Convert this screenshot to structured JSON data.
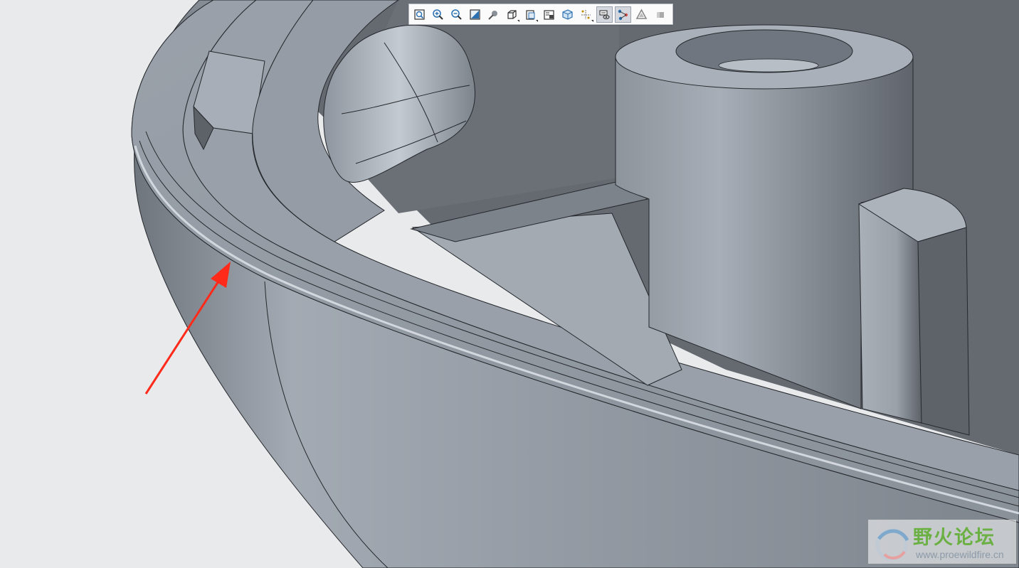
{
  "toolbar": {
    "buttons": [
      {
        "icon": "refit-icon",
        "active": false
      },
      {
        "icon": "zoom-in-icon",
        "active": false
      },
      {
        "icon": "zoom-out-icon",
        "active": false
      },
      {
        "icon": "repaint-icon",
        "active": false
      },
      {
        "icon": "spin-center-icon",
        "active": false
      },
      {
        "icon": "display-style-icon",
        "active": false,
        "dropdown": true
      },
      {
        "icon": "saved-orientations-icon",
        "active": false,
        "dropdown": true
      },
      {
        "icon": "view-manager-icon",
        "active": false
      },
      {
        "icon": "perspective-view-icon",
        "active": false
      },
      {
        "icon": "datum-display-icon",
        "active": false,
        "dropdown": true
      },
      {
        "icon": "annotation-display-icon",
        "active": true
      },
      {
        "icon": "spin-center-toggle-icon",
        "active": true
      },
      {
        "icon": "appearance-icon",
        "active": false
      },
      {
        "icon": "section-view-icon",
        "active": false
      }
    ]
  },
  "watermark": {
    "title": "野火论坛",
    "url": "www.proewildfire.cn"
  },
  "colors": {
    "background": "#e9eaec",
    "model_light": "#a9b0b9",
    "model_mid": "#8e959e",
    "model_dark": "#5c6168",
    "edge": "#25282c",
    "arrow": "#ff2a1a"
  }
}
